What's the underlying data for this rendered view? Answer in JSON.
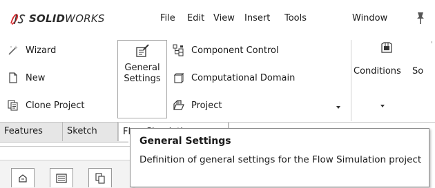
{
  "app": {
    "brand_bold": "SOLID",
    "brand_light": "WORKS"
  },
  "menu": [
    {
      "label": "File"
    },
    {
      "label": "Edit"
    },
    {
      "label": "View"
    },
    {
      "label": "Insert"
    },
    {
      "label": "Tools"
    },
    {
      "label": "Window"
    }
  ],
  "ribbon": {
    "col1": [
      {
        "label": "Wizard",
        "icon": "wand-icon"
      },
      {
        "label": "New",
        "icon": "new-document-icon"
      },
      {
        "label": "Clone Project",
        "icon": "clone-project-icon"
      }
    ],
    "general_settings": {
      "label": "General Settings",
      "icon": "general-settings-icon"
    },
    "col3": [
      {
        "label": "Component Control",
        "icon": "component-control-icon"
      },
      {
        "label": "Computational Domain",
        "icon": "computational-domain-icon"
      },
      {
        "label": "Project",
        "icon": "project-icon"
      }
    ],
    "conditions": {
      "label": "Conditions",
      "icon": "conditions-icon"
    },
    "truncated_next": "So"
  },
  "tabs": [
    {
      "label": "Features"
    },
    {
      "label": "Sketch"
    },
    {
      "label": "Flow Simulation"
    }
  ],
  "tooltip": {
    "title": "General Settings",
    "body": "Definition of general settings for the Flow Simulation project"
  },
  "colors": {
    "accent_red": "#d8262a",
    "tab_bg": "#e6e6e6",
    "tooltip_border": "#8d8d8d"
  }
}
